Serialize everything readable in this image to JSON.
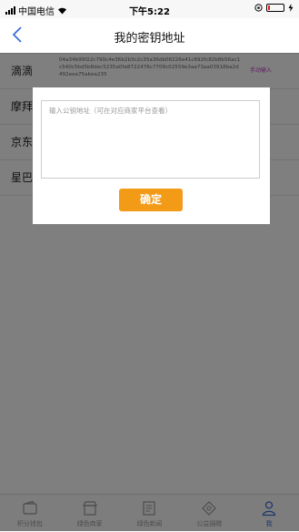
{
  "status_bar": {
    "carrier": "中国电信",
    "time": "下午5:22"
  },
  "nav": {
    "title": "我的密钥地址"
  },
  "rows": [
    {
      "name": "滴滴",
      "address": "04a34b99f22c790c4e36b2b3c2c35a36db06226e41c692fc82b8b56ac1c540c5bd5b8dec5235a0fa8722476c7709c02559e3aa73aa03918ba2d492eea75abea235",
      "action": "手动输入"
    },
    {
      "name": "摩拜",
      "address": "",
      "action": ""
    },
    {
      "name": "京东",
      "address": "",
      "action": ""
    },
    {
      "name": "星巴",
      "address": "",
      "action": ""
    }
  ],
  "dialog": {
    "placeholder": "输入公钥地址（可在对应商家平台查看）",
    "confirm_label": "确定"
  },
  "tabs": [
    {
      "label": "积分钱包",
      "icon": "wallet-icon"
    },
    {
      "label": "绿色商家",
      "icon": "shop-icon"
    },
    {
      "label": "绿色新闻",
      "icon": "news-icon"
    },
    {
      "label": "公益捐赠",
      "icon": "donate-icon"
    },
    {
      "label": "我",
      "icon": "user-icon",
      "active": true
    }
  ],
  "colors": {
    "confirm": "#f39a16",
    "active_tab": "#3a6fd8",
    "action_text": "#c040c0"
  }
}
